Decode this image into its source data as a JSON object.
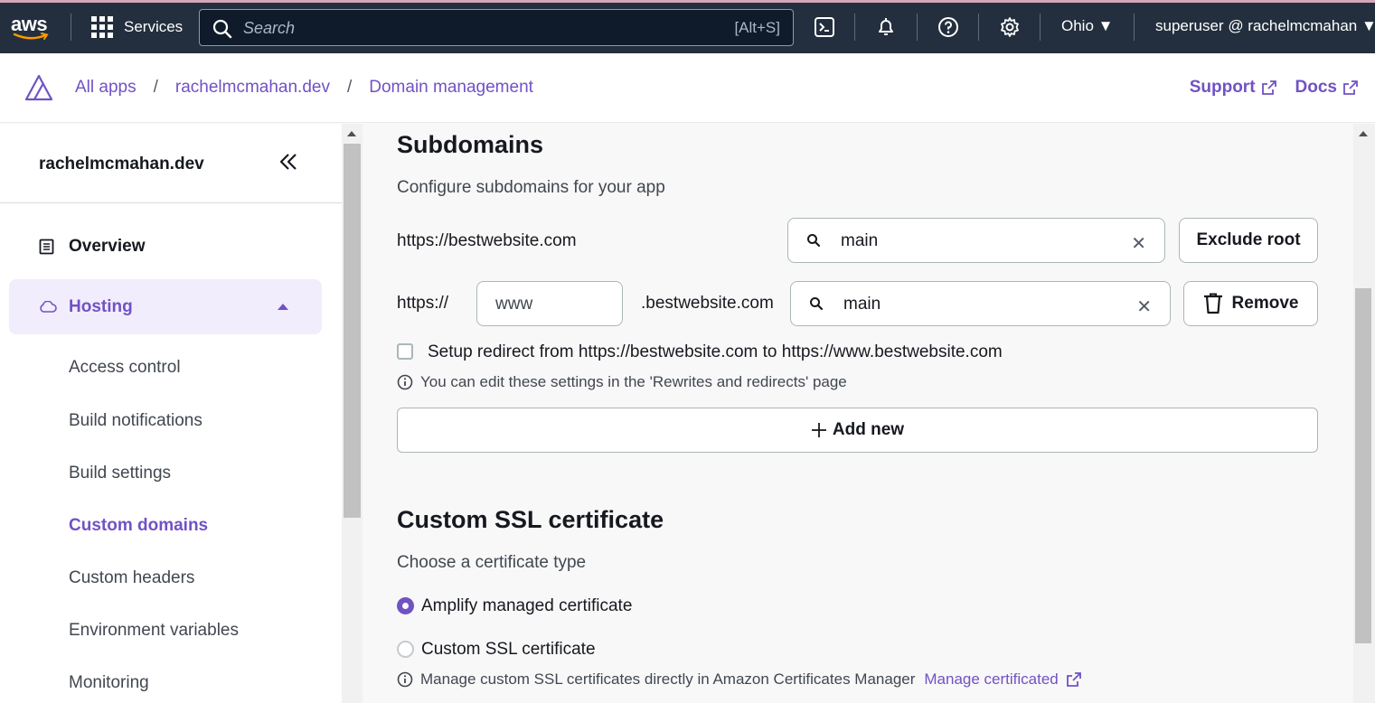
{
  "topbar": {
    "logo_text": "aws",
    "services_label": "Services",
    "search_placeholder": "Search",
    "search_shortcut": "[Alt+S]",
    "region": "Ohio ▼",
    "user": "superuser @ rachelmcmahan ▼"
  },
  "breadcrumb": {
    "items": [
      "All apps",
      "rachelmcmahan.dev",
      "Domain management"
    ],
    "separator": "/",
    "support_label": "Support",
    "docs_label": "Docs"
  },
  "sidebar": {
    "app_name": "rachelmcmahan.dev",
    "overview_label": "Overview",
    "hosting_label": "Hosting",
    "sub_items": [
      {
        "label": "Access control",
        "active": false
      },
      {
        "label": "Build notifications",
        "active": false
      },
      {
        "label": "Build settings",
        "active": false
      },
      {
        "label": "Custom domains",
        "active": true
      },
      {
        "label": "Custom headers",
        "active": false
      },
      {
        "label": "Environment variables",
        "active": false
      },
      {
        "label": "Monitoring",
        "active": false
      }
    ]
  },
  "subdomains": {
    "heading": "Subdomains",
    "description": "Configure subdomains for your app",
    "root_url": "https://bestwebsite.com",
    "root_branch": "main",
    "exclude_root_label": "Exclude root",
    "prefix": "https://",
    "subdomain_value": "www",
    "domain_suffix": ".bestwebsite.com",
    "sub_branch": "main",
    "remove_label": "Remove",
    "redirect_label": "Setup redirect from https://bestwebsite.com to https://www.bestwebsite.com",
    "redirect_info": "You can edit these settings in the 'Rewrites and redirects' page",
    "add_new_label": "Add new"
  },
  "ssl": {
    "heading": "Custom SSL certificate",
    "description": "Choose a certificate type",
    "option_managed": "Amplify managed certificate",
    "option_custom": "Custom SSL certificate",
    "selected": "managed",
    "info_text": "Manage custom SSL certificates directly in Amazon Certificates Manager",
    "info_link": "Manage certificated"
  },
  "colors": {
    "accent": "#7152c4",
    "topbar_bg": "#232f3e",
    "hosting_bg": "#f2edfd"
  }
}
